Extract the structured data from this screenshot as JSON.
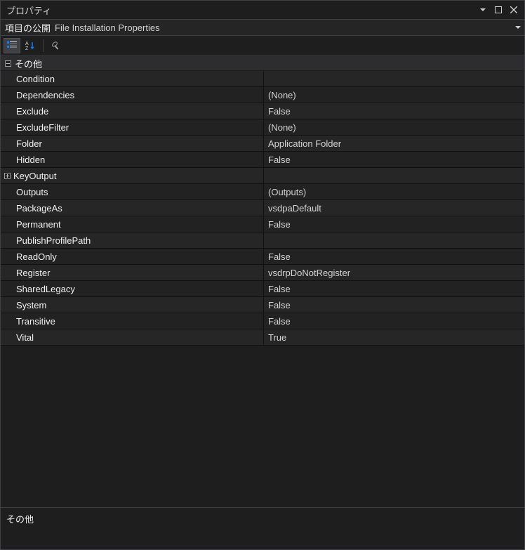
{
  "titlebar": {
    "title": "プロパティ"
  },
  "object": {
    "name": "項目の公開",
    "type": "File Installation Properties"
  },
  "toolbar": {
    "categorized": "categorized-view",
    "alphabetical": "alphabetical-view",
    "property_pages": "property-pages"
  },
  "categories": [
    {
      "label": "その他",
      "expanded": true,
      "rows": [
        {
          "name": "Condition",
          "value": "",
          "expandable": false
        },
        {
          "name": "Dependencies",
          "value": "(None)",
          "expandable": false
        },
        {
          "name": "Exclude",
          "value": "False",
          "expandable": false
        },
        {
          "name": "ExcludeFilter",
          "value": "(None)",
          "expandable": false
        },
        {
          "name": "Folder",
          "value": "Application Folder",
          "expandable": false
        },
        {
          "name": "Hidden",
          "value": "False",
          "expandable": false
        },
        {
          "name": "KeyOutput",
          "value": "",
          "expandable": true,
          "expanded": false
        },
        {
          "name": "Outputs",
          "value": "(Outputs)",
          "expandable": false
        },
        {
          "name": "PackageAs",
          "value": "vsdpaDefault",
          "expandable": false
        },
        {
          "name": "Permanent",
          "value": "False",
          "expandable": false
        },
        {
          "name": "PublishProfilePath",
          "value": "",
          "expandable": false
        },
        {
          "name": "ReadOnly",
          "value": "False",
          "expandable": false
        },
        {
          "name": "Register",
          "value": "vsdrpDoNotRegister",
          "expandable": false
        },
        {
          "name": "SharedLegacy",
          "value": "False",
          "expandable": false
        },
        {
          "name": "System",
          "value": "False",
          "expandable": false
        },
        {
          "name": "Transitive",
          "value": "False",
          "expandable": false
        },
        {
          "name": "Vital",
          "value": "True",
          "expandable": false
        }
      ]
    }
  ],
  "description": {
    "title": "その他",
    "body": ""
  }
}
